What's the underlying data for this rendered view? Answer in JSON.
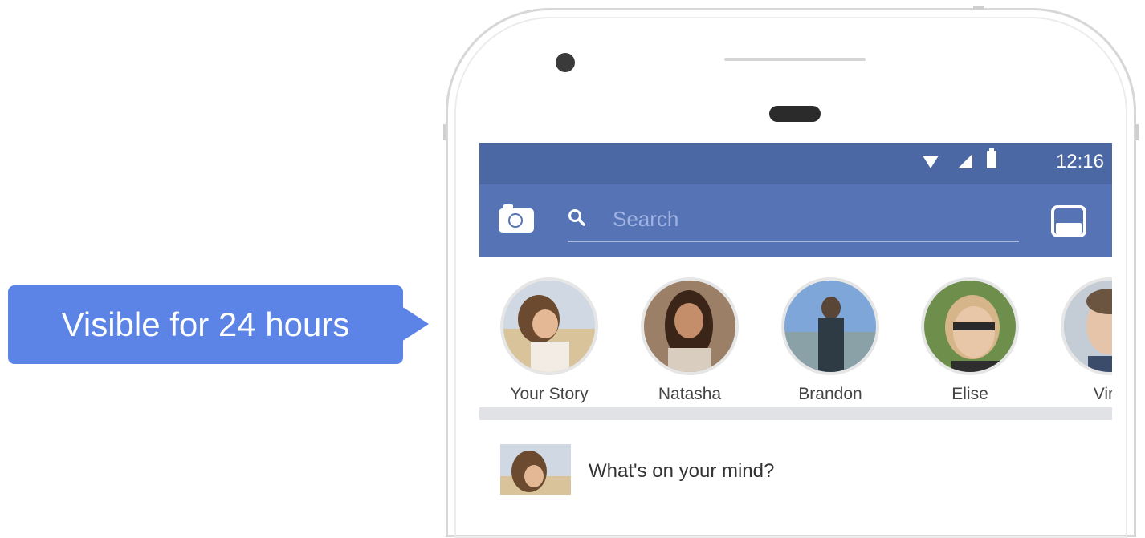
{
  "callout": {
    "text": "Visible for 24 hours",
    "color": "#5b84e6"
  },
  "status_bar": {
    "time": "12:16",
    "icons": [
      "wifi-icon",
      "signal-icon",
      "battery-icon"
    ]
  },
  "nav_bar": {
    "left_icon": "camera-icon",
    "search_placeholder": "Search",
    "right_icon": "inbox-icon",
    "color": "#5673b5"
  },
  "stories": [
    {
      "label": "Your Story"
    },
    {
      "label": "Natasha"
    },
    {
      "label": "Brandon"
    },
    {
      "label": "Elise"
    },
    {
      "label": "Vinc"
    }
  ],
  "composer": {
    "prompt": "What's on your mind?"
  }
}
